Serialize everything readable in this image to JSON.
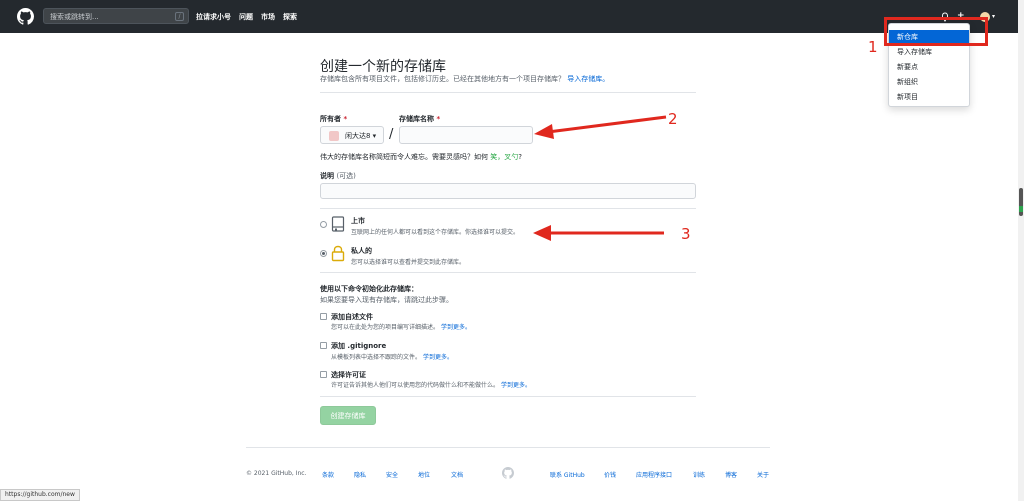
{
  "header": {
    "search_placeholder": "搜索或跳转到...",
    "search_key": "/",
    "nav": [
      "拉请求小号",
      "问题",
      "市场",
      "探索"
    ],
    "plus": "+",
    "caret": "▾"
  },
  "dropdown": {
    "items": [
      "新仓库",
      "导入存储库",
      "新要点",
      "新组织",
      "新项目"
    ]
  },
  "annotations": {
    "n1": "1",
    "n2": "2",
    "n3": "3"
  },
  "page": {
    "title": "创建一个新的存储库",
    "subtitle": "存储库包含所有项目文件，包括修订历史。已经在其他地方有一个项目存储库？",
    "subtitle_link": "导入存储库。",
    "owner_label": "所有者",
    "repo_label": "存储库名称",
    "required_mark": "*",
    "owner_name": "闲大达8 ▾",
    "separator": "/",
    "hint_prefix": "伟大的存储库名称简短而令人难忘。需要灵感吗？如何",
    "hint_suggestion": "笑，叉勺",
    "hint_suffix": "?",
    "desc_label": "说明",
    "desc_optional": "(可选)",
    "public_title": "上市",
    "public_desc": "互联网上的任何人都可以看到这个存储库。你选择谁可以提交。",
    "private_title": "私人的",
    "private_desc": "您可以选择谁可以查看并提交到此存储库。",
    "init_title": "使用以下命令初始化此存储库：",
    "init_sub": "如果您要导入现有存储库，请跳过此步骤。",
    "readme_title": "添加自述文件",
    "readme_desc": "您可以在此处为您的项目编写详细描述。",
    "gitignore_title": "添加 .gitignore",
    "gitignore_desc": "从模板列表中选择不跟踪的文件。",
    "license_title": "选择许可证",
    "license_desc": "许可证告诉其他人他们可以使用您的代码做什么和不能做什么。",
    "learn_more": "学到更多。",
    "create_button": "创建存储库"
  },
  "footer": {
    "copyright": "© 2021 GitHub, Inc.",
    "left_links": [
      "条款",
      "隐私",
      "安全",
      "地位",
      "文档"
    ],
    "right_links": [
      "联系 GitHub",
      "价钱",
      "应用程序接口",
      "训练",
      "博客",
      "关于"
    ]
  },
  "status_url": "https://github.com/new",
  "colors": {
    "accent": "#0366d6",
    "annotation": "#e0281e",
    "create_button": "#94d3a2",
    "header": "#24292e"
  }
}
